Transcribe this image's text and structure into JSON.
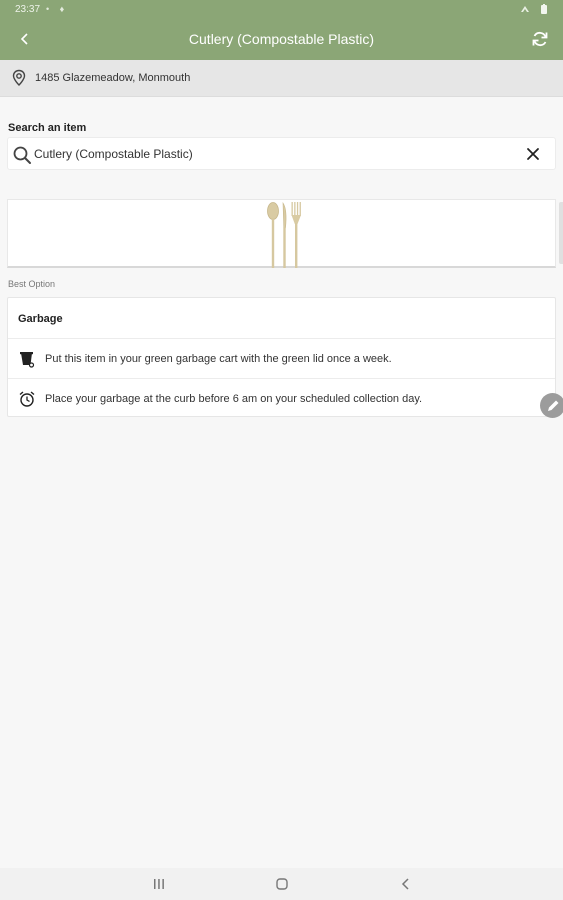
{
  "status_bar": {
    "time": "23:37",
    "indicators": "•  ♦"
  },
  "header": {
    "title": "Cutlery (Compostable Plastic)",
    "background": "#8ba676"
  },
  "location": {
    "address": "1485 Glazemeadow, Monmouth"
  },
  "search": {
    "label": "Search an item",
    "value": "Cutlery (Compostable Plastic)"
  },
  "result": {
    "best_option_label": "Best Option",
    "category": "Garbage",
    "instructions": [
      {
        "icon": "garbage-cart-icon",
        "text": "Put this item in your green garbage cart with the green lid once a week."
      },
      {
        "icon": "alarm-clock-icon",
        "text": "Place your garbage at the curb before 6 am on your scheduled collection day."
      }
    ]
  },
  "icons": {
    "back": "back-arrow-icon",
    "refresh": "refresh-icon",
    "location": "location-pin-icon",
    "search": "search-icon",
    "clear": "close-icon",
    "edit": "pencil-icon",
    "item_image": "cutlery-icon"
  }
}
